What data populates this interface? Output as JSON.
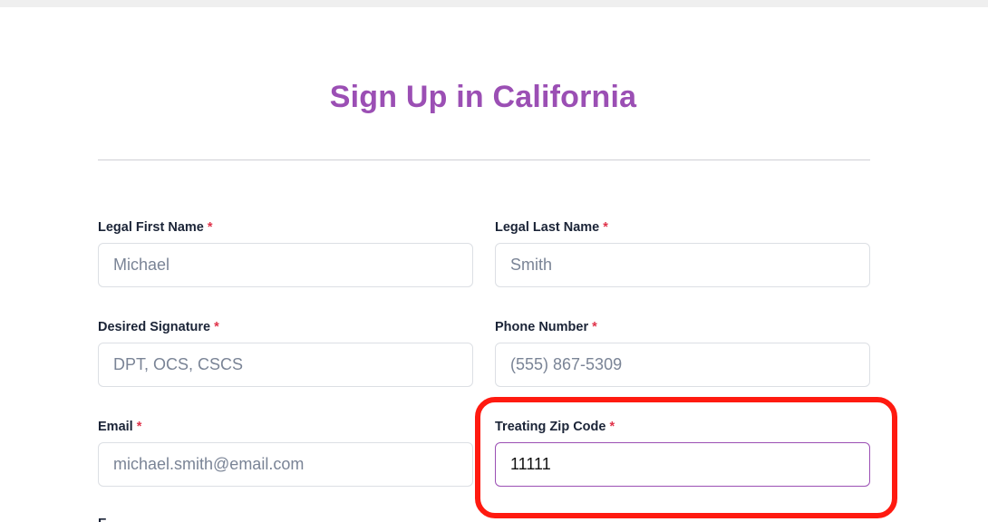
{
  "form": {
    "title": "Sign Up in California",
    "required_marker": "*",
    "fields": {
      "first_name": {
        "label": "Legal First Name",
        "placeholder": "Michael",
        "value": ""
      },
      "last_name": {
        "label": "Legal Last Name",
        "placeholder": "Smith",
        "value": ""
      },
      "signature": {
        "label": "Desired Signature",
        "placeholder": "DPT, OCS, CSCS",
        "value": ""
      },
      "phone": {
        "label": "Phone Number",
        "placeholder": "(555) 867-5309",
        "value": ""
      },
      "email": {
        "label": "Email",
        "placeholder": "michael.smith@email.com",
        "value": ""
      },
      "zip": {
        "label": "Treating Zip Code",
        "placeholder": "",
        "value": "11111"
      }
    },
    "next_label_partial": "E"
  },
  "colors": {
    "title": "#9b4fb4",
    "required": "#e0334a",
    "active_border": "#9b4fb4",
    "annotation": "#ff1a10"
  }
}
